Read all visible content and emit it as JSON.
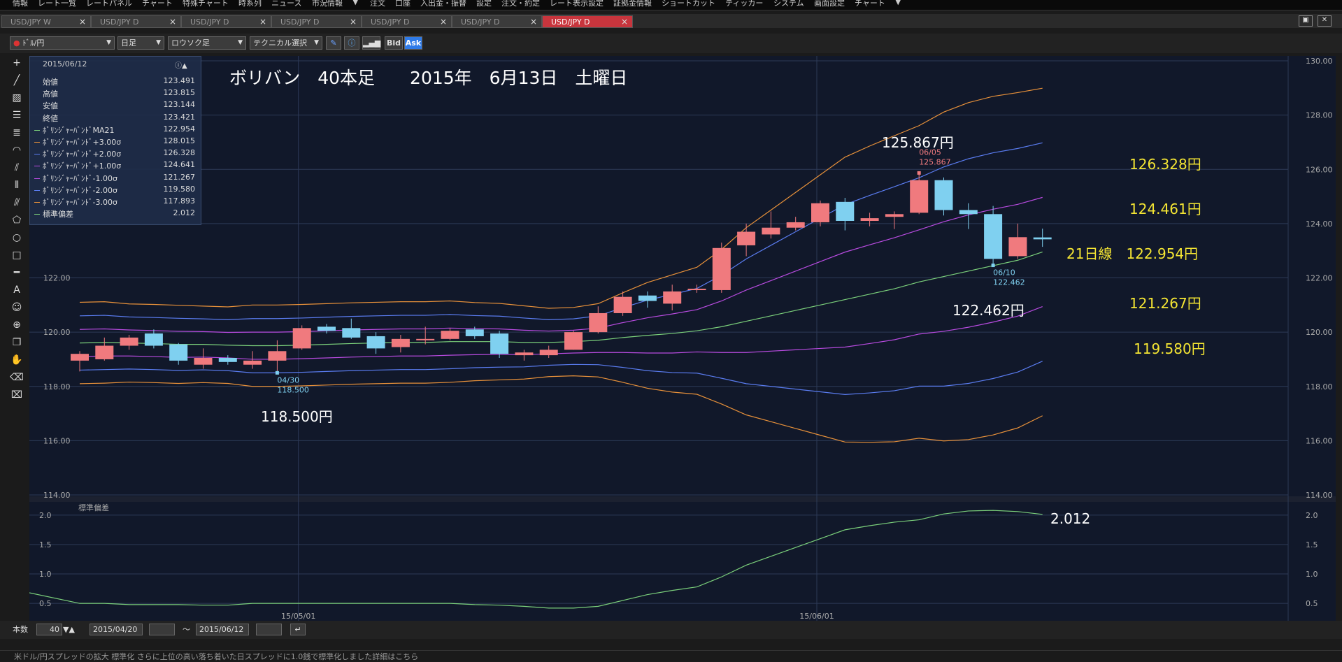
{
  "menu": {
    "items": [
      "情報",
      "レート一覧",
      "レートパネル",
      "チャート",
      "特殊チャート",
      "時系列",
      "ニュース",
      "市況情報",
      "▼",
      "注文",
      "口座",
      "入出金・振替",
      "設定",
      "注文・約定",
      "レート表示設定",
      "証拠金情報",
      "ショートカット",
      "ティッカー",
      "システム",
      "画面設定",
      "チャート",
      "▼"
    ]
  },
  "tabs": [
    {
      "label": "USD/JPY W",
      "close": "×"
    },
    {
      "label": "USD/JPY D",
      "close": "×"
    },
    {
      "label": "USD/JPY D",
      "close": "×"
    },
    {
      "label": "USD/JPY D",
      "close": "×"
    },
    {
      "label": "USD/JPY D",
      "close": "×"
    },
    {
      "label": "USD/JPY D",
      "close": "×"
    },
    {
      "label": "USD/JPY D",
      "close": "×",
      "active": true
    }
  ],
  "toolbar": {
    "pair": "ﾄﾞﾙ/円",
    "period": "日足",
    "chart_kind": "ロウソク足",
    "technical": "テクニカル選択",
    "bid": "Bid",
    "ask": "Ask"
  },
  "infobox": {
    "date": "2015/06/12",
    "rows": [
      {
        "label": "始値",
        "value": "123.491",
        "color": ""
      },
      {
        "label": "高値",
        "value": "123.815",
        "color": ""
      },
      {
        "label": "安値",
        "value": "123.144",
        "color": ""
      },
      {
        "label": "終値",
        "value": "123.421",
        "color": ""
      },
      {
        "label": "ﾎﾞﾘﾝｼﾞｬｰﾊﾞﾝﾄﾞMA21",
        "value": "122.954",
        "color": "#7bd07b"
      },
      {
        "label": "ﾎﾞﾘﾝｼﾞｬｰﾊﾞﾝﾄﾞ+3.00σ",
        "value": "128.015",
        "color": "#e8913a"
      },
      {
        "label": "ﾎﾞﾘﾝｼﾞｬｰﾊﾞﾝﾄﾞ+2.00σ",
        "value": "126.328",
        "color": "#5a7cf0"
      },
      {
        "label": "ﾎﾞﾘﾝｼﾞｬｰﾊﾞﾝﾄﾞ+1.00σ",
        "value": "124.641",
        "color": "#b84be0"
      },
      {
        "label": "ﾎﾞﾘﾝｼﾞｬｰﾊﾞﾝﾄﾞ-1.00σ",
        "value": "121.267",
        "color": "#b84be0"
      },
      {
        "label": "ﾎﾞﾘﾝｼﾞｬｰﾊﾞﾝﾄﾞ-2.00σ",
        "value": "119.580",
        "color": "#5a7cf0"
      },
      {
        "label": "ﾎﾞﾘﾝｼﾞｬｰﾊﾞﾝﾄﾞ-3.00σ",
        "value": "117.893",
        "color": "#e8913a"
      },
      {
        "label": "標準偏差",
        "value": "2.012",
        "color": "#7bd07b"
      }
    ]
  },
  "annotations": {
    "title": "ボリバン　40本足　　2015年　6月13日　土曜日",
    "high_label": "125.867円",
    "low_label": "118.500円",
    "low2_label": "122.462円",
    "p2": "126.328円",
    "p1": "124.461円",
    "ma_label": "21日線　122.954円",
    "m1": "121.267円",
    "m2": "119.580円",
    "sd_label": "2.012",
    "marker_high_date": "06/05",
    "marker_high_val": "125.867",
    "marker_low_date": "04/30",
    "marker_low_val": "118.500",
    "marker_low2_date": "06/10",
    "marker_low2_val": "122.462",
    "sd_panel_title": "標準偏差"
  },
  "colors": {
    "up": "#f07a7e",
    "down": "#7fd0f0",
    "ma": "#7bd07b",
    "sigma1": "#b84be0",
    "sigma2": "#5a7cf0",
    "sigma3": "#e8913a",
    "yellow": "#f4e533"
  },
  "bottom": {
    "count_label": "本数",
    "count_value": "40",
    "from_date": "2015/04/20",
    "tilde": "〜",
    "to_date": "2015/06/12",
    "status_text": "米ドル/円スプレッドの拡大 標準化 さらに上位の高い落ち着いた日スプレッドに1.0銭で標準化しました詳細はこちら"
  },
  "chart_data": {
    "type": "candlestick",
    "instrument": "USD/JPY",
    "period": "daily",
    "ylim": [
      114,
      130
    ],
    "yticks": [
      "130.00",
      "128.00",
      "126.00",
      "124.00",
      "122.00",
      "120.00",
      "118.00",
      "116.00",
      "114.00"
    ],
    "xlabels": [
      {
        "label": "15/05/01",
        "index": 9
      },
      {
        "label": "15/06/01",
        "index": 30
      }
    ],
    "candles": [
      {
        "o": 118.95,
        "h": 119.3,
        "c": 119.2,
        "l": 118.55
      },
      {
        "o": 119.0,
        "h": 119.8,
        "c": 119.5,
        "l": 118.95
      },
      {
        "o": 119.5,
        "h": 119.9,
        "c": 119.8,
        "l": 119.35
      },
      {
        "o": 119.95,
        "h": 120.1,
        "c": 119.5,
        "l": 119.4
      },
      {
        "o": 119.55,
        "h": 119.6,
        "c": 118.95,
        "l": 118.8
      },
      {
        "o": 118.8,
        "h": 119.4,
        "c": 119.05,
        "l": 118.65
      },
      {
        "o": 119.05,
        "h": 119.15,
        "c": 118.9,
        "l": 118.8
      },
      {
        "o": 118.8,
        "h": 119.3,
        "c": 118.95,
        "l": 118.65
      },
      {
        "o": 118.95,
        "h": 119.7,
        "c": 119.3,
        "l": 118.5
      },
      {
        "o": 119.4,
        "h": 120.25,
        "c": 120.15,
        "l": 119.35
      },
      {
        "o": 120.2,
        "h": 120.3,
        "c": 120.05,
        "l": 119.95
      },
      {
        "o": 120.15,
        "h": 120.5,
        "c": 119.8,
        "l": 119.75
      },
      {
        "o": 119.85,
        "h": 120.0,
        "c": 119.4,
        "l": 119.2
      },
      {
        "o": 119.45,
        "h": 119.9,
        "c": 119.75,
        "l": 119.25
      },
      {
        "o": 119.75,
        "h": 120.2,
        "c": 119.75,
        "l": 119.55
      },
      {
        "o": 119.75,
        "h": 120.15,
        "c": 120.05,
        "l": 119.7
      },
      {
        "o": 120.1,
        "h": 120.2,
        "c": 119.85,
        "l": 119.75
      },
      {
        "o": 119.95,
        "h": 120.05,
        "c": 119.2,
        "l": 119.05
      },
      {
        "o": 119.15,
        "h": 119.35,
        "c": 119.25,
        "l": 118.95
      },
      {
        "o": 119.15,
        "h": 119.5,
        "c": 119.35,
        "l": 119.05
      },
      {
        "o": 119.35,
        "h": 120.05,
        "c": 120.0,
        "l": 119.35
      },
      {
        "o": 120.0,
        "h": 120.95,
        "c": 120.7,
        "l": 119.95
      },
      {
        "o": 120.7,
        "h": 121.5,
        "c": 121.3,
        "l": 120.6
      },
      {
        "o": 121.35,
        "h": 121.5,
        "c": 121.15,
        "l": 120.9
      },
      {
        "o": 121.05,
        "h": 121.75,
        "c": 121.5,
        "l": 120.8
      },
      {
        "o": 121.55,
        "h": 121.75,
        "c": 121.6,
        "l": 121.45
      },
      {
        "o": 121.55,
        "h": 123.3,
        "c": 123.1,
        "l": 121.45
      },
      {
        "o": 123.2,
        "h": 124.0,
        "c": 123.7,
        "l": 122.8
      },
      {
        "o": 123.6,
        "h": 124.45,
        "c": 123.85,
        "l": 123.45
      },
      {
        "o": 123.85,
        "h": 124.25,
        "c": 124.05,
        "l": 123.75
      },
      {
        "o": 124.05,
        "h": 124.85,
        "c": 124.75,
        "l": 123.9
      },
      {
        "o": 124.8,
        "h": 124.95,
        "c": 124.1,
        "l": 123.75
      },
      {
        "o": 124.1,
        "h": 124.4,
        "c": 124.2,
        "l": 123.9
      },
      {
        "o": 124.25,
        "h": 124.45,
        "c": 124.35,
        "l": 123.8
      },
      {
        "o": 124.4,
        "h": 125.867,
        "c": 125.6,
        "l": 124.35
      },
      {
        "o": 125.6,
        "h": 125.7,
        "c": 124.5,
        "l": 124.3
      },
      {
        "o": 124.5,
        "h": 124.75,
        "c": 124.35,
        "l": 123.8
      },
      {
        "o": 124.35,
        "h": 124.65,
        "c": 122.7,
        "l": 122.462
      },
      {
        "o": 122.8,
        "h": 124.0,
        "c": 123.5,
        "l": 122.7
      },
      {
        "o": 123.491,
        "h": 123.815,
        "c": 123.421,
        "l": 123.144
      }
    ],
    "ma21": [
      119.6,
      119.62,
      119.6,
      119.58,
      119.55,
      119.55,
      119.52,
      119.5,
      119.5,
      119.52,
      119.55,
      119.58,
      119.6,
      119.62,
      119.62,
      119.65,
      119.65,
      119.65,
      119.62,
      119.62,
      119.65,
      119.7,
      119.8,
      119.88,
      119.95,
      120.05,
      120.2,
      120.4,
      120.6,
      120.8,
      121.0,
      121.2,
      121.4,
      121.6,
      121.85,
      122.05,
      122.25,
      122.45,
      122.65,
      122.954
    ],
    "sigma": [
      0.5,
      0.5,
      0.48,
      0.48,
      0.48,
      0.47,
      0.47,
      0.5,
      0.5,
      0.5,
      0.5,
      0.5,
      0.5,
      0.5,
      0.5,
      0.5,
      0.48,
      0.47,
      0.45,
      0.42,
      0.42,
      0.45,
      0.55,
      0.65,
      0.72,
      0.78,
      0.95,
      1.15,
      1.3,
      1.45,
      1.6,
      1.75,
      1.82,
      1.88,
      1.92,
      2.02,
      2.07,
      2.08,
      2.06,
      2.012
    ],
    "sd_ylim": [
      0.3,
      2.2
    ],
    "sd_yticks": [
      "2.0",
      "1.5",
      "1.0",
      "0.5"
    ]
  }
}
